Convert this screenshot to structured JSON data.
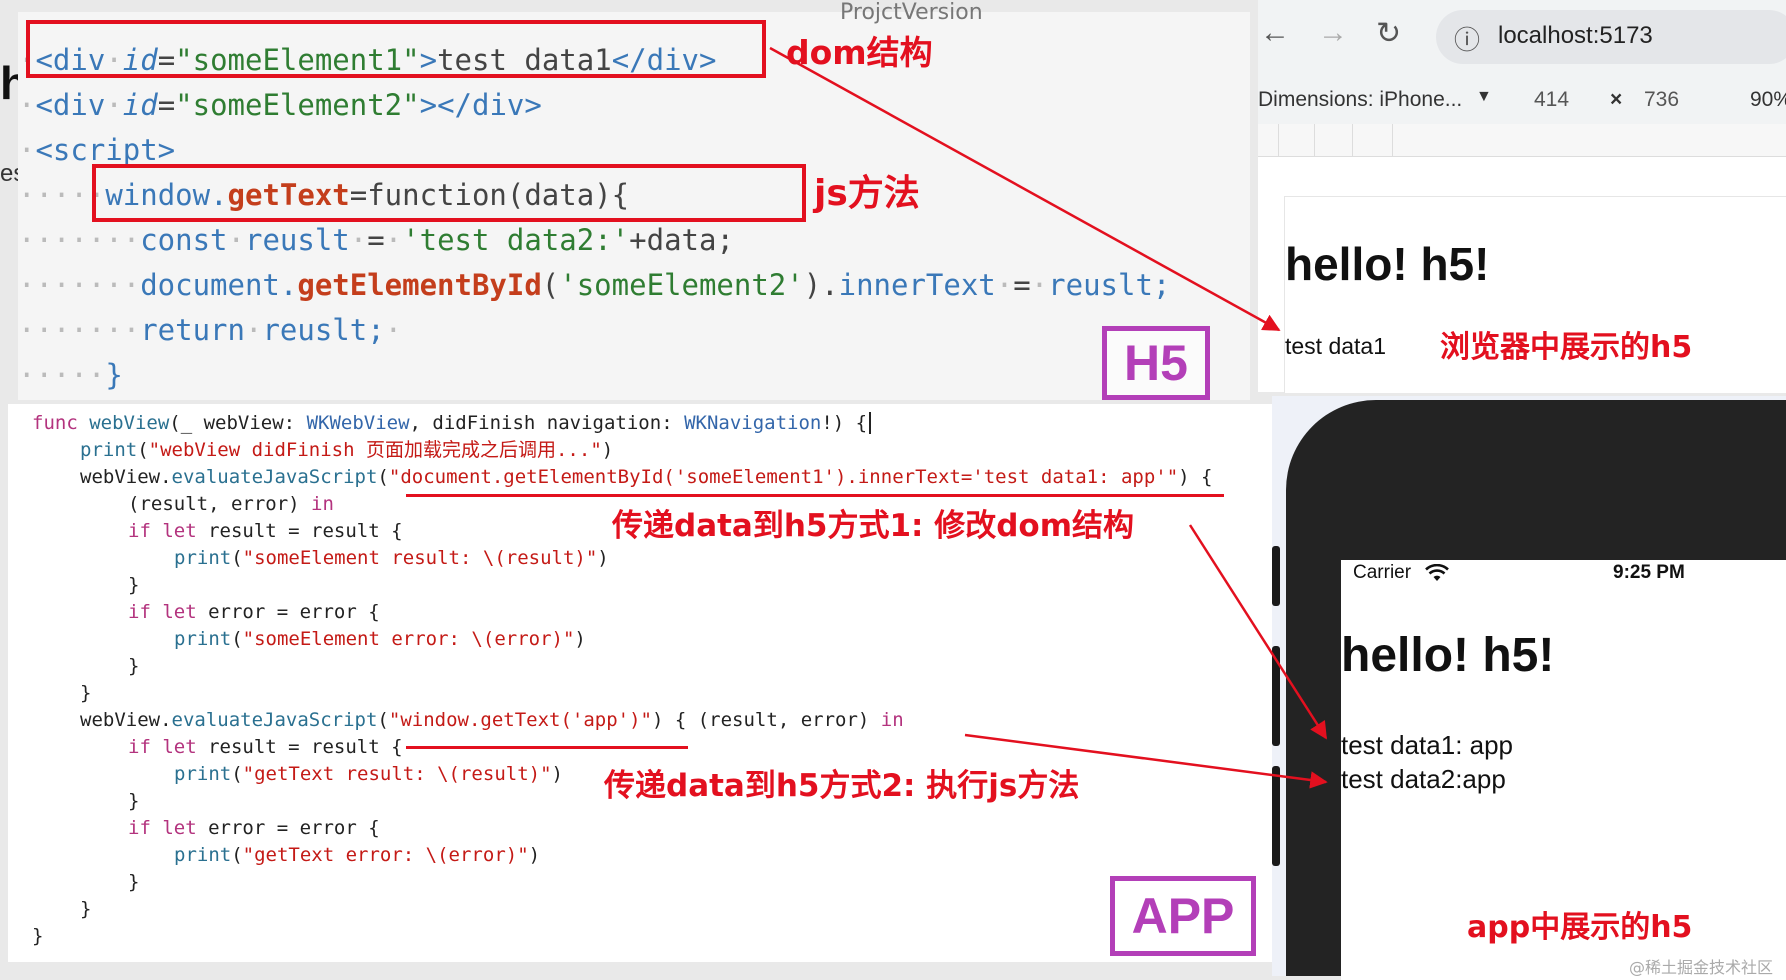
{
  "h5_code": {
    "partial_title": "ProjctVersion",
    "line1": {
      "open": "<div",
      "attr": "id",
      "val": "\"someElement1\"",
      "text": "test data1",
      "close": "</div>"
    },
    "line2": {
      "open": "<div",
      "attr": "id",
      "val": "\"someElement2\"",
      "close": "></div>"
    },
    "line3": "<script>",
    "line4": {
      "obj": "window.",
      "fn": "getText",
      "rest": "=function(data){"
    },
    "line5": {
      "kw": "const",
      "var": "reuslt",
      "eq": "=",
      "str": "'test data2:'",
      "rest": "+data;"
    },
    "line6": {
      "obj": "document.",
      "fn": "getElementById",
      "open": "(",
      "str": "'someElement2'",
      "close": ").",
      "prop": "innerText",
      "eq": "=",
      "var": "reuslt;"
    },
    "line7": {
      "kw": "return",
      "var": "reuslt;"
    },
    "line8": "}",
    "left_edge_glyphs": [
      "h",
      "es"
    ]
  },
  "annotations": {
    "dom_structure": "dom结构",
    "js_method": "js方法",
    "browser_h5": "浏览器中展示的h5",
    "way1": "传递data到h5方式1: 修改dom结构",
    "way2": "传递data到h5方式2: 执行js方法",
    "app_h5": "app中展示的h5"
  },
  "tags": {
    "h5": "H5",
    "app": "APP"
  },
  "browser": {
    "back_icon": "←",
    "forward_icon": "→",
    "reload_icon": "↻",
    "info_icon": "ⓘ",
    "url": "localhost:5173",
    "dimensions_label": "Dimensions: iPhone...",
    "dropdown_icon": "▼",
    "width": "414",
    "times": "×",
    "height": "736",
    "zoom": "90%",
    "page_title": "hello! h5!",
    "page_text": "test data1"
  },
  "swift_code": {
    "l1": {
      "kw": "func",
      "fn": "webView",
      "p1": "(_ webView: ",
      "t1": "WKWebView",
      "p2": ", didFinish navigation: ",
      "t2": "WKNavigation",
      "p3": "!) {"
    },
    "l2": {
      "fn": "print",
      "open": "(",
      "str": "\"webView didFinish 页面加载完成之后调用...\"",
      "close": ")"
    },
    "l3": {
      "obj": "webView.",
      "fn": "evaluateJavaScript",
      "open": "(",
      "str": "\"document.getElementById('someElement1').innerText='test data1: app'\"",
      "close": ") {"
    },
    "l4": {
      "p": "(result, error) ",
      "kw": "in"
    },
    "l5": {
      "kw": "if let",
      "rest": " result = result {"
    },
    "l6": {
      "fn": "print",
      "open": "(",
      "str": "\"someElement result: \\(result)\"",
      "close": ")"
    },
    "l7": "}",
    "l8": {
      "kw": "if let",
      "rest": " error = error {"
    },
    "l9": {
      "fn": "print",
      "open": "(",
      "str": "\"someElement error: \\(error)\"",
      "close": ")"
    },
    "l10": "}",
    "l11": "}",
    "l12": {
      "obj": "webView.",
      "fn": "evaluateJavaScript",
      "open": "(",
      "str": "\"window.getText('app')\"",
      "close": ") { (result, error) ",
      "kw": "in"
    },
    "l13": {
      "kw": "if let",
      "rest": " result = result {"
    },
    "l14": {
      "fn": "print",
      "open": "(",
      "str": "\"getText result: \\(result)\"",
      "close": ")"
    },
    "l15": "}",
    "l16": {
      "kw": "if let",
      "rest": " error = error {"
    },
    "l17": {
      "fn": "print",
      "open": "(",
      "str": "\"getText error: \\(error)\"",
      "close": ")"
    },
    "l18": "}",
    "l19": "}",
    "l20": "}"
  },
  "phone": {
    "carrier": "Carrier",
    "wifi_icon": "wifi-icon",
    "time": "9:25 PM",
    "title": "hello! h5!",
    "line1": "test data1: app",
    "line2": "test data2:app"
  },
  "watermark": "@稀土掘金技术社区",
  "colors": {
    "annotation": "#e3101f",
    "tag": "#b33fb8"
  }
}
